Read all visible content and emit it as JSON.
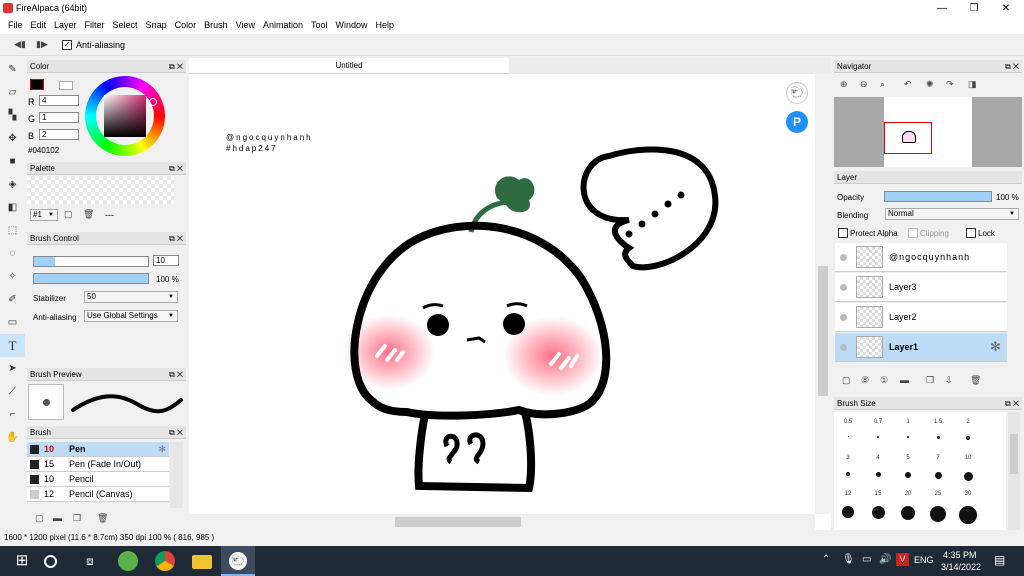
{
  "window": {
    "title": "FireAlpaca (64bit)",
    "minimize": "—",
    "maximize": "❐",
    "close": "✕"
  },
  "menu": [
    "File",
    "Edit",
    "Layer",
    "Filter",
    "Select",
    "Snap",
    "Color",
    "Brush",
    "View",
    "Animation",
    "Tool",
    "Window",
    "Help"
  ],
  "toolbar": {
    "antialias_label": "Anti-aliasing",
    "antialias_checked": "✓"
  },
  "color_panel": {
    "title": "Color",
    "r": "4",
    "g": "1",
    "b": "2",
    "hex": "#040102",
    "r_label": "R",
    "g_label": "G",
    "b_label": "B"
  },
  "palette_panel": {
    "title": "Palette",
    "palette_no": "#1",
    "palette_dash": "---"
  },
  "brush_control": {
    "title": "Brush Control",
    "size": "10",
    "opacity": "100 %",
    "stabilizer_label": "Stabilizer",
    "stabilizer_value": "50",
    "antialias_label": "Anti-aliasing",
    "antialias_value": "Use Global Settings"
  },
  "brush_preview": {
    "title": "Brush Preview"
  },
  "brush_list": {
    "title": "Brush",
    "items": [
      {
        "size": "10",
        "name": "Pen",
        "selected": true
      },
      {
        "size": "15",
        "name": "Pen (Fade In/Out)"
      },
      {
        "size": "10",
        "name": "Pencil"
      },
      {
        "size": "12",
        "name": "Pencil (Canvas)"
      }
    ]
  },
  "canvas": {
    "tab": "Untitled",
    "watermark1": "@ngocquynhanh",
    "watermark2": "#hdap247"
  },
  "navigator": {
    "title": "Navigator"
  },
  "layer_panel": {
    "title": "Layer",
    "opacity_label": "Opacity",
    "opacity_value": "100 %",
    "blending_label": "Blending",
    "blending_value": "Normal",
    "protect_alpha": "Protect Alpha",
    "clipping": "Clipping",
    "lock": "Lock",
    "layers": [
      {
        "name": "@ngocquynhanh"
      },
      {
        "name": "Layer3"
      },
      {
        "name": "Layer2"
      },
      {
        "name": "Layer1",
        "selected": true
      }
    ]
  },
  "brush_size": {
    "title": "Brush Size",
    "row1": [
      "0.5",
      "0.7",
      "1",
      "1.5",
      "2"
    ],
    "row2": [
      "3",
      "4",
      "5",
      "7",
      "10"
    ],
    "row3": [
      "12",
      "15",
      "20",
      "25",
      "30"
    ]
  },
  "status": {
    "text": "1600 * 1200 pixel  (11.6 * 8.7cm)  350 dpi  100 %  ( 816, 985 )"
  },
  "taskbar": {
    "time": "4:35 PM",
    "date": "3/14/2022",
    "lang": "ENG"
  }
}
